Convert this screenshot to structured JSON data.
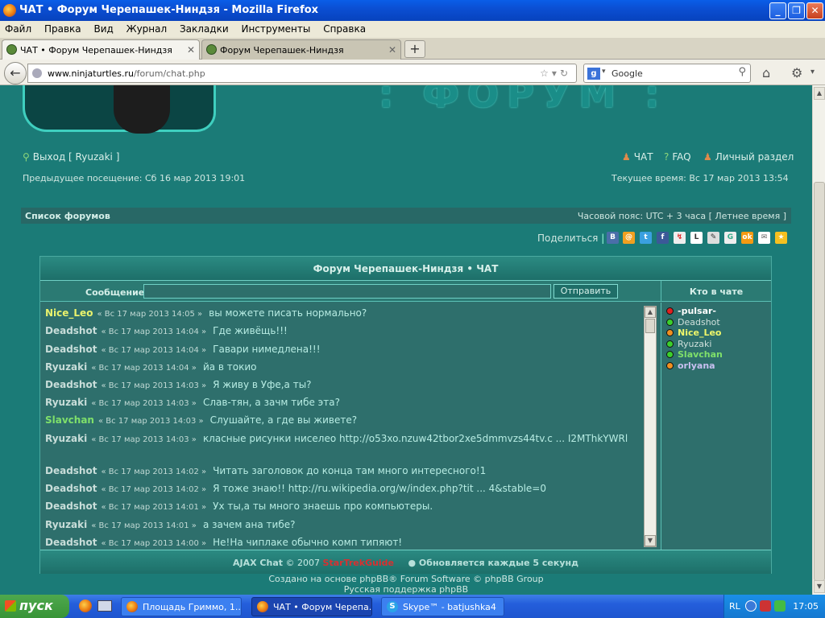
{
  "window": {
    "title": "ЧАТ • Форум Черепашек-Ниндзя - Mozilla Firefox",
    "minimize": "_",
    "restore": "❐",
    "close": "✕"
  },
  "menu": [
    "Файл",
    "Правка",
    "Вид",
    "Журнал",
    "Закладки",
    "Инструменты",
    "Справка"
  ],
  "tabs": [
    {
      "label": "ЧАТ • Форум Черепашек-Ниндзя",
      "active": true
    },
    {
      "label": "Форум Черепашек-Ниндзя",
      "active": false
    }
  ],
  "tab_close": "✕",
  "new_tab": "+",
  "navbar": {
    "url_host": "www.ninjaturtles.ru",
    "url_path": "/forum/chat.php",
    "search_placeholder": "Google",
    "search_engine": "g"
  },
  "site": {
    "banner_text": ": ФОРУМ :",
    "logout": "Выход [ Ryuzaki ]",
    "chat_link": "ЧАТ",
    "faq_link": "FAQ",
    "profile_link": "Личный раздел",
    "last_visit": "Предыдущее посещение: Сб 16 мар 2013 19:01",
    "current_time": "Текущее время: Вс 17 мар 2013 13:54",
    "forum_list": "Список форумов",
    "timezone": "Часовой пояс: UTC + 3 часа [ Летнее время ]",
    "share": "Поделиться"
  },
  "chat": {
    "title": "Форум Черепашек-Ниндзя • ЧАТ",
    "message_label": "Сообщение:",
    "message_value": "",
    "send_button": "Отправить",
    "who_title": "Кто в чате",
    "messages": [
      {
        "user": "Nice_Leo",
        "color": "yellow",
        "time": "« Вс 17 мар 2013 14:05 »",
        "text": "вы можете писать нормально?"
      },
      {
        "user": "Deadshot",
        "color": "gray",
        "time": "« Вс 17 мар 2013 14:04 »",
        "text": "Где живёщь!!!"
      },
      {
        "user": "Deadshot",
        "color": "gray",
        "time": "« Вс 17 мар 2013 14:04 »",
        "text": "Гавари нимедлена!!!"
      },
      {
        "user": "Ryuzaki",
        "color": "gray",
        "time": "« Вс 17 мар 2013 14:04 »",
        "text": "йа в токио"
      },
      {
        "user": "Deadshot",
        "color": "gray",
        "time": "« Вс 17 мар 2013 14:03 »",
        "text": "Я живу в Уфе,а ты?"
      },
      {
        "user": "Ryuzaki",
        "color": "gray",
        "time": "« Вс 17 мар 2013 14:03 »",
        "text": "Слав-тян, а зачм тибе эта?"
      },
      {
        "user": "Slavchan",
        "color": "green",
        "time": "« Вс 17 мар 2013 14:03 »",
        "text": "Слушайте, а где вы живете?"
      },
      {
        "user": "Ryuzaki",
        "color": "gray",
        "time": "« Вс 17 мар 2013 14:03 »",
        "text": "класные рисунки ниселео http://o53xo.nzuw42tbor2xe5dmmvzs44tv.c ... I2MThkYWRl"
      },
      {
        "user": "Deadshot",
        "color": "gray",
        "time": "« Вс 17 мар 2013 14:02 »",
        "text": "Читать заголовок до конца там много интересного!1"
      },
      {
        "user": "Deadshot",
        "color": "gray",
        "time": "« Вс 17 мар 2013 14:02 »",
        "text": "Я тоже знаю!! http://ru.wikipedia.org/w/index.php?tit ... 4&stable=0"
      },
      {
        "user": "Deadshot",
        "color": "gray",
        "time": "« Вс 17 мар 2013 14:01 »",
        "text": "Ух ты,а ты много знаешь про компьютеры."
      },
      {
        "user": "Ryuzaki",
        "color": "gray",
        "time": "« Вс 17 мар 2013 14:01 »",
        "text": "а зачем ана тибе?"
      },
      {
        "user": "Deadshot",
        "color": "gray",
        "time": "« Вс 17 мар 2013 14:00 »",
        "text": "Не!На чиплаке обычно комп типяют!"
      }
    ],
    "who": [
      {
        "name": "-pulsar-",
        "status": "red",
        "style": "bold-white"
      },
      {
        "name": "Deadshot",
        "status": "green",
        "style": "normal"
      },
      {
        "name": "Nice_Leo",
        "status": "orange",
        "style": "yellow"
      },
      {
        "name": "Ryuzaki",
        "status": "green",
        "style": "normal"
      },
      {
        "name": "Slavchan",
        "status": "green",
        "style": "green"
      },
      {
        "name": "orlyana",
        "status": "orange",
        "style": "lavender"
      }
    ],
    "footer_prefix": "AJAX Chat",
    "footer_copy": "© 2007",
    "footer_brand": "StarTrekGuide",
    "footer_refresh": "● Обновляется каждые 5 секунд"
  },
  "footer": {
    "line1": "Создано на основе phpBB® Forum Software © phpBB Group",
    "line2": "Русская поддержка phpBB"
  },
  "taskbar": {
    "start": "пуск",
    "tasks": [
      {
        "label": "Площадь Гриммо, 1...",
        "active": false,
        "icon": "firefox-icon"
      },
      {
        "label": "ЧАТ • Форум Черепа...",
        "active": true,
        "icon": "firefox-icon"
      },
      {
        "label": "Skype™ - batjushka4",
        "active": false,
        "icon": "skype-icon"
      }
    ],
    "lang": "RL",
    "clock": "17:05"
  },
  "colors": {
    "page_bg": "#1b7b77",
    "accent": "#6fd0c5"
  }
}
